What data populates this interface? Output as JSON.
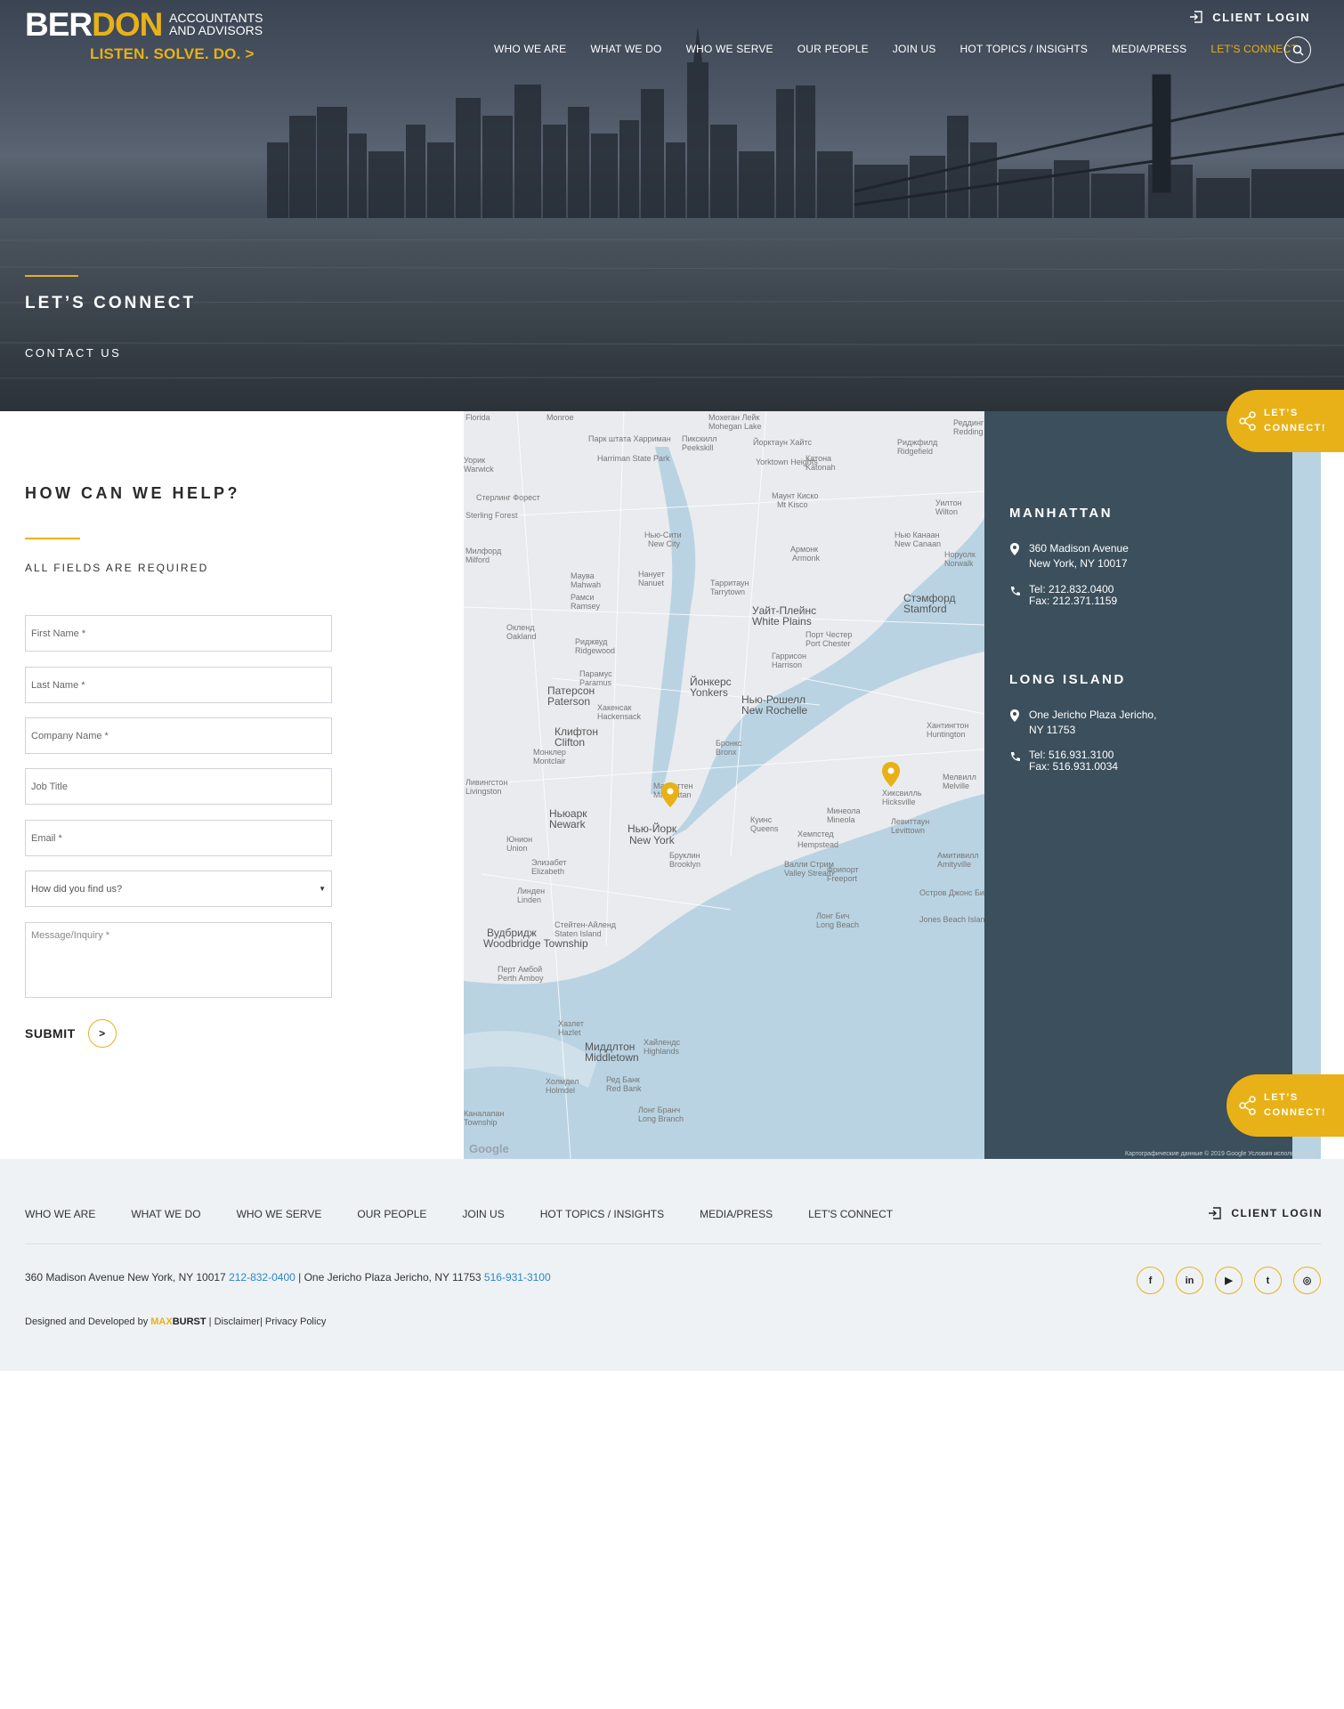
{
  "header": {
    "logo": {
      "brand_a": "BER",
      "brand_b": "DON",
      "sub": "ACCOUNTANTS AND ADVISORS",
      "tagline": "LISTEN. SOLVE. DO. >"
    },
    "client_login": "CLIENT LOGIN",
    "nav": [
      {
        "label": "WHO WE ARE"
      },
      {
        "label": "WHAT WE DO"
      },
      {
        "label": "WHO WE SERVE"
      },
      {
        "label": "OUR PEOPLE"
      },
      {
        "label": "JOIN US"
      },
      {
        "label": "HOT TOPICS / INSIGHTS"
      },
      {
        "label": "MEDIA/PRESS"
      },
      {
        "label": "LET'S CONNECT"
      }
    ],
    "active_color": "#e8b117"
  },
  "hero": {
    "title": "LET’S CONNECT",
    "subtitle": "CONTACT US"
  },
  "floating": {
    "line1": "LET’S",
    "line2": "CONNECT!"
  },
  "form": {
    "heading": "HOW CAN WE HELP?",
    "required_note": "ALL FIELDS ARE REQUIRED",
    "first_name_ph": "First Name *",
    "last_name_ph": "Last Name *",
    "company_ph": "Company Name *",
    "job_title_ph": "Job Title",
    "email_ph": "Email *",
    "find_us_value": "How did you find us?",
    "message_ph": "Message/Inquiry *",
    "submit_label": "SUBMIT",
    "submit_arrow": ">"
  },
  "map": {
    "labels": [
      "Florida",
      "Monroe",
      "Мохеган Лейк",
      "Mohegan Lake",
      "Реддинг",
      "Redding",
      "Парк штата Харриман",
      "Harriman State Park",
      "Пикскилл",
      "Peekskill",
      "Йорктаун Хайтс",
      "Yorktown Heights",
      "Катона",
      "Katonah",
      "Риджфилд",
      "Ridgefield",
      "Уорик",
      "Warwick",
      "Стерлинг Форест",
      "Sterling Forest",
      "Маунт Киско",
      "Mt Kisco",
      "Уилтон",
      "Wilton",
      "Нью-Сити",
      "New City",
      "Милфорд",
      "Milford",
      "Армонк",
      "Armonk",
      "Нью Канаан",
      "New Canaan",
      "Норуолк",
      "Norwalk",
      "Маува",
      "Mahwah",
      "Нанует",
      "Nanuet",
      "Рамси",
      "Ramsey",
      "Тарритаун",
      "Tarrytown",
      "Стэмфорд",
      "Stamford",
      "Уайт-Плейнс",
      "White Plains",
      "Окленд",
      "Oakland",
      "Порт Честер",
      "Port Chester",
      "Риджвуд",
      "Ridgewood",
      "Гаррисон",
      "Harrison",
      "Парамус",
      "Paramus",
      "Патерсон",
      "Paterson",
      "Йонкерс",
      "Yonkers",
      "Нью-Рошелл",
      "New Rochelle",
      "Хакенсак",
      "Hackensack",
      "Клифтон",
      "Clifton",
      "Хантингтон",
      "Huntington",
      "Бронкс",
      "Bronx",
      "Монклер",
      "Montclair",
      "Ливингстон",
      "Livingston",
      "Манхэттен",
      "Manhattan",
      "Хиксвилль",
      "Hicksville",
      "Мелвилл",
      "Melville",
      "Ньюарк",
      "Newark",
      "Минеола",
      "Mineola",
      "Куинс",
      "Queens",
      "Левиттаун",
      "Levittown",
      "Нью-Йорк",
      "New York",
      "Хемпстед",
      "Hempstead",
      "Юнион",
      "Union",
      "Бруклин",
      "Brooklyn",
      "Амитивилл",
      "Amityville",
      "Элизабет",
      "Elizabeth",
      "Валли Стрим",
      "Valley Stream",
      "Фрипорт",
      "Freeport",
      "Линден",
      "Linden",
      "Остров Джонс Бич",
      "Jones Beach Island",
      "Стейтен-Айленд",
      "Staten Island",
      "Лонг Бич",
      "Long Beach",
      "Вудбридж",
      "Woodbridge Township",
      "Перт Амбой",
      "Perth Amboy",
      "Хазлет",
      "Hazlet",
      "Хайлендс",
      "Highlands",
      "Миддлтон",
      "Middletown",
      "Ред Банк",
      "Red Bank",
      "Холмдел",
      "Holmdel",
      "Лонг Бранч",
      "Long Branch",
      "Каналапан Township",
      "Google"
    ],
    "pins": [
      {
        "name": "manhattan",
        "color": "#e8b117"
      },
      {
        "name": "long-island",
        "color": "#e8b117"
      }
    ],
    "attribution": "Картографические данные © 2019 Google   Условия использования"
  },
  "locations": {
    "manhattan": {
      "title": "MANHATTAN",
      "addr1": "360 Madison Avenue",
      "addr2": "New York, NY 10017",
      "tel": "Tel: 212.832.0400",
      "fax": "Fax: 212.371.1159"
    },
    "long_island": {
      "title": "LONG ISLAND",
      "addr1": "One Jericho Plaza Jericho,",
      "addr2": "NY 11753",
      "tel": "Tel: 516.931.3100",
      "fax": "Fax: 516.931.0034"
    }
  },
  "footer": {
    "nav": [
      {
        "label": "WHO WE ARE"
      },
      {
        "label": "WHAT WE DO"
      },
      {
        "label": "WHO WE SERVE"
      },
      {
        "label": "OUR PEOPLE"
      },
      {
        "label": "JOIN US"
      },
      {
        "label": "HOT TOPICS / INSIGHTS"
      },
      {
        "label": "MEDIA/PRESS"
      },
      {
        "label": "LET'S CONNECT"
      }
    ],
    "client_login": "CLIENT LOGIN",
    "address_1": "360 Madison Avenue New York, NY 10017 ",
    "phone_1": "212-832-0400",
    "address_sep": " | One Jericho Plaza Jericho, NY 11753 ",
    "phone_2": "516-931-3100",
    "credits_prefix": "Designed and Developed by ",
    "credits_brand_a": "MAX",
    "credits_brand_b": "BURST",
    "disclaimer": "Disclaimer",
    "privacy": "Privacy Policy",
    "socials": [
      {
        "name": "facebook-icon",
        "glyph": "f"
      },
      {
        "name": "linkedin-icon",
        "glyph": "in"
      },
      {
        "name": "youtube-icon",
        "glyph": "▶"
      },
      {
        "name": "twitter-icon",
        "glyph": "t"
      },
      {
        "name": "instagram-icon",
        "glyph": "◎"
      }
    ]
  }
}
